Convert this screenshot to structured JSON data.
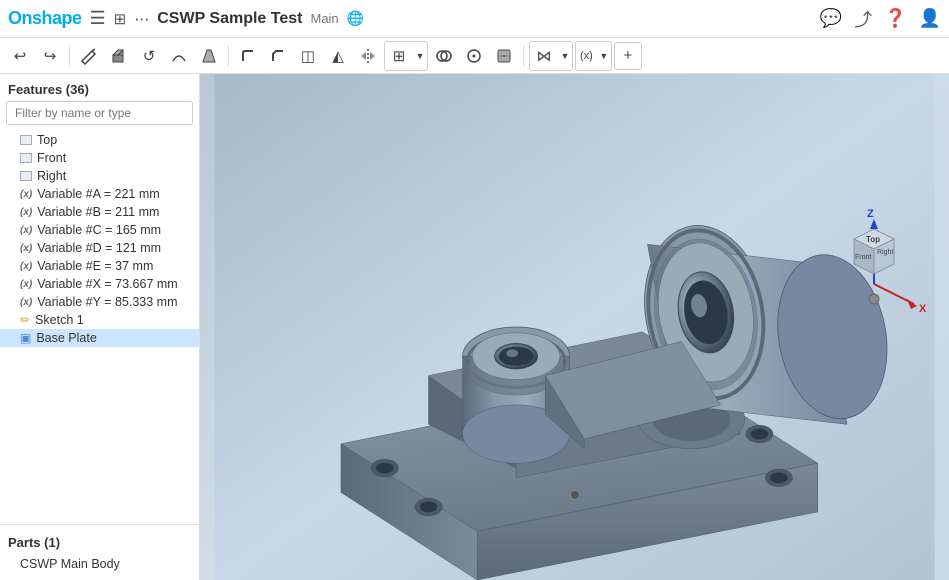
{
  "topbar": {
    "logo": "Onshape",
    "doc_title": "CSWP Sample Test",
    "branch_label": "Main",
    "hamburger_icon": "☰",
    "workflow_icon": "⊞",
    "settings_icon": "⋯",
    "globe_icon": "🌐",
    "chat_icon": "💬",
    "share_icon": "↗",
    "help_icon": "?",
    "user_icon": "👤"
  },
  "toolbar": {
    "tools": [
      {
        "name": "undo",
        "icon": "↩",
        "label": "Undo"
      },
      {
        "name": "redo",
        "icon": "↪",
        "label": "Redo"
      },
      {
        "name": "sketch",
        "icon": "✏",
        "label": "Sketch"
      },
      {
        "name": "extrude",
        "icon": "▣",
        "label": "Extrude"
      },
      {
        "name": "revolve",
        "icon": "↺",
        "label": "Revolve"
      },
      {
        "name": "sweep",
        "icon": "〜",
        "label": "Sweep"
      },
      {
        "name": "loft",
        "icon": "◈",
        "label": "Loft"
      },
      {
        "name": "fillet",
        "icon": "◉",
        "label": "Fillet"
      },
      {
        "name": "chamfer",
        "icon": "◧",
        "label": "Chamfer"
      },
      {
        "name": "shell",
        "icon": "◫",
        "label": "Shell"
      },
      {
        "name": "draft",
        "icon": "◭",
        "label": "Draft"
      },
      {
        "name": "mirror",
        "icon": "⧖",
        "label": "Mirror"
      },
      {
        "name": "pattern",
        "icon": "⊞",
        "label": "Pattern"
      },
      {
        "name": "boolean",
        "icon": "⊕",
        "label": "Boolean"
      },
      {
        "name": "measure",
        "icon": "⊙",
        "label": "Measure"
      },
      {
        "name": "mate",
        "icon": "⊛",
        "label": "Mate"
      },
      {
        "name": "variables",
        "icon": "(x)",
        "label": "Variables"
      },
      {
        "name": "plus",
        "icon": "+",
        "label": "Add"
      }
    ]
  },
  "sidebar": {
    "features_header": "Features (36)",
    "filter_placeholder": "Filter by name or type",
    "planes": [
      {
        "name": "Top",
        "type": "plane"
      },
      {
        "name": "Front",
        "type": "plane"
      },
      {
        "name": "Right",
        "type": "plane"
      }
    ],
    "variables": [
      {
        "name": "Variable #A = 221 mm"
      },
      {
        "name": "Variable #B = 211 mm"
      },
      {
        "name": "Variable #C = 165 mm"
      },
      {
        "name": "Variable #D = 121 mm"
      },
      {
        "name": "Variable #E = 37 mm"
      },
      {
        "name": "Variable #X = 73.667 mm"
      },
      {
        "name": "Variable #Y = 85.333 mm"
      }
    ],
    "sketch_name": "Sketch 1",
    "baseplate_name": "Base Plate",
    "parts_header": "Parts (1)",
    "parts": [
      {
        "name": "CSWP Main Body"
      }
    ]
  }
}
